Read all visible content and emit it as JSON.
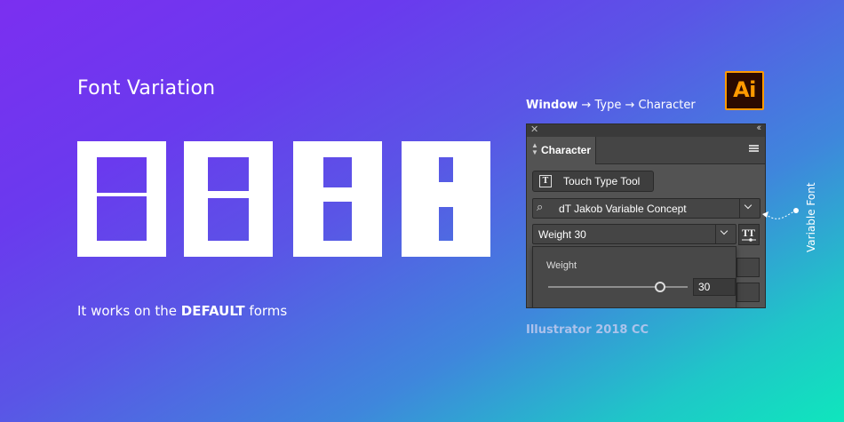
{
  "headline": "Font Variation",
  "tagline": {
    "prefix": "It works on the ",
    "bold": "DEFAULT",
    "suffix": " forms"
  },
  "breadcrumb": {
    "window": "Window",
    "arrow1": " → ",
    "type": "Type",
    "arrow2": " → ",
    "character": "Character"
  },
  "app_logo": {
    "text": "Ai",
    "color": "#ff9a00",
    "background": "#2b0a00"
  },
  "panel": {
    "tab_label": "Character",
    "touch_type_label": "Touch Type Tool",
    "font_name": "dT Jakob Variable Concept",
    "font_style": "Weight 30",
    "weight_popup": {
      "label": "Weight",
      "value": "30",
      "slider_fraction": 0.8
    }
  },
  "caption": "Illustrator 2018 CC",
  "variable_font_label": "Variable Font",
  "glyphs": [
    {
      "char": "H",
      "weight_level": "thin"
    },
    {
      "char": "H",
      "weight_level": "light"
    },
    {
      "char": "H",
      "weight_level": "regular"
    },
    {
      "char": "H",
      "weight_level": "bold"
    }
  ],
  "colors": {
    "gradient_start": "#7b2ff0",
    "gradient_end": "#0fe6bd",
    "panel_bg": "#535353"
  }
}
